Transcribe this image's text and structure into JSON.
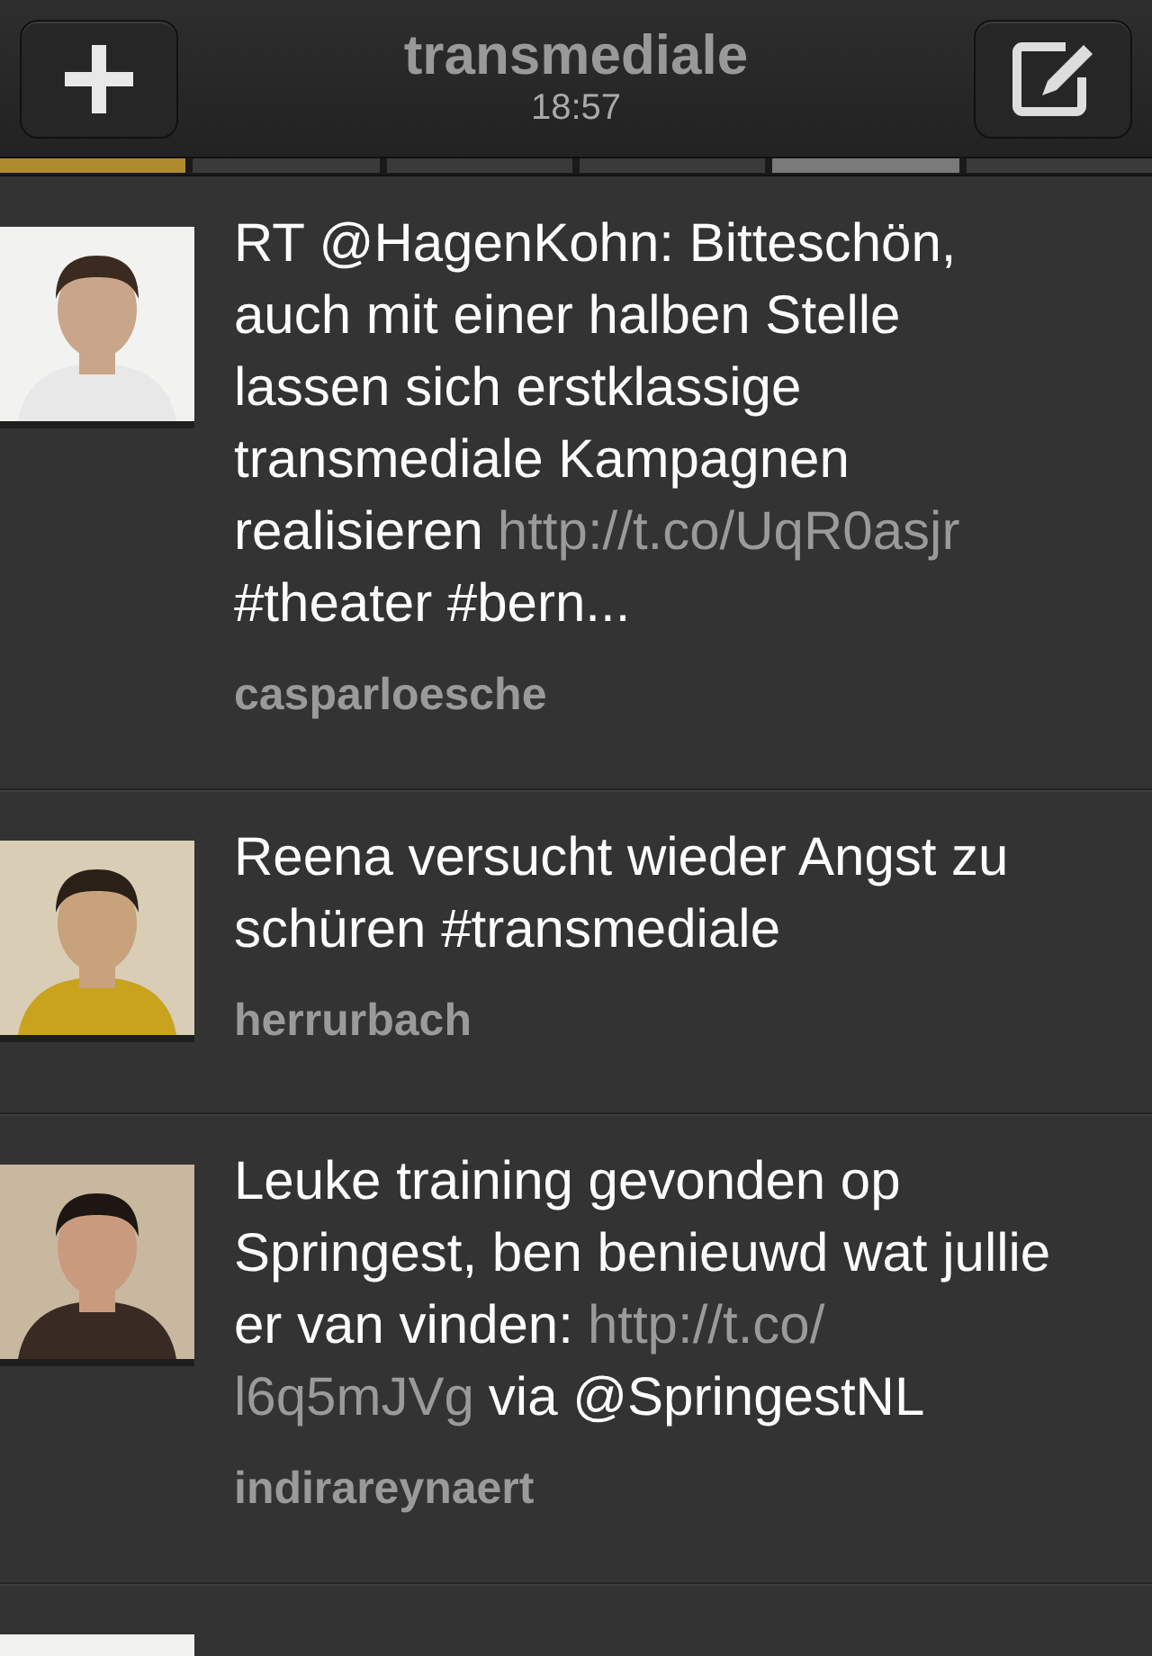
{
  "header": {
    "title": "transmediale",
    "time": "18:57"
  },
  "page_segments": [
    {
      "color": "#b08a2e"
    },
    {
      "color": "#3a3a3a"
    },
    {
      "color": "#3a3a3a"
    },
    {
      "color": "#3a3a3a"
    },
    {
      "color": "#7a7a7a"
    },
    {
      "color": "#3a3a3a"
    }
  ],
  "tweets": [
    {
      "avatar": {
        "kind": "picture"
      },
      "lines": [
        [
          {
            "kind": "text",
            "text": "RT @HagenKohn: Bitteschön,"
          }
        ],
        [
          {
            "kind": "text",
            "text": "auch mit einer halben Stelle"
          }
        ],
        [
          {
            "kind": "text",
            "text": "lassen sich erstklassige"
          }
        ],
        [
          {
            "kind": "text",
            "text": "transmediale Kampagnen"
          }
        ],
        [
          {
            "kind": "text",
            "text": "realisieren"
          },
          {
            "kind": "link",
            "text": "http://t.co/UqR0asjr"
          }
        ],
        [
          {
            "kind": "text",
            "text": "#theater #bern..."
          }
        ]
      ],
      "user": "casparloesche"
    },
    {
      "avatar": {
        "kind": "picture"
      },
      "lines": [
        [
          {
            "kind": "text",
            "text": "Reena versucht wieder Angst zu"
          }
        ],
        [
          {
            "kind": "text",
            "text": "schüren #transmediale"
          }
        ]
      ],
      "user": "herrurbach"
    },
    {
      "avatar": {
        "kind": "picture"
      },
      "lines": [
        [
          {
            "kind": "text",
            "text": "Leuke training gevonden op"
          }
        ],
        [
          {
            "kind": "text",
            "text": "Springest, ben benieuwd wat jullie"
          }
        ],
        [
          {
            "kind": "text",
            "text": "er van vinden:"
          },
          {
            "kind": "link",
            "text": "http://t.co/"
          }
        ],
        [
          {
            "kind": "link",
            "text": "l6q5mJVg"
          },
          {
            "kind": "text",
            "text": "via @SpringestNL"
          }
        ]
      ],
      "user": "indirareynaert"
    },
    {
      "avatar": {
        "kind": "picture"
      }
    }
  ]
}
